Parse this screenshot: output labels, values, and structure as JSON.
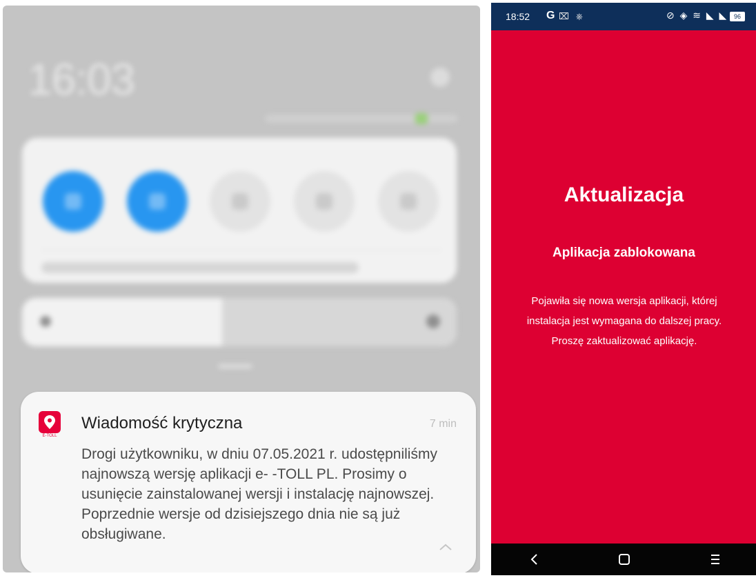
{
  "left_screen": {
    "lock_time": "16:03",
    "notification": {
      "app_icon": "e-toll-app-icon",
      "app_icon_caption": "E-TOLL",
      "title": "Wiadomość krytyczna",
      "time": "7 min",
      "body": "Drogi użytkowniku, w dniu 07.05.2021 r. udostępniliśmy najnowszą wersję aplikacji e-\n-TOLL PL. Prosimy o usunięcie zainstalowanej wersji i instalację najnowszej. Poprzednie wersje od dzisiejszego dnia nie są już obsługiwane.",
      "expand_icon": "chevron-up-icon"
    },
    "quick_tiles": [
      {
        "icon": "pencil-icon",
        "state": "on"
      },
      {
        "icon": "wifi-icon",
        "state": "on"
      },
      {
        "icon": "flashlight-icon",
        "state": "off"
      },
      {
        "icon": "vibrate-icon",
        "state": "off"
      },
      {
        "icon": "screenshot-icon",
        "state": "off"
      }
    ],
    "colors": {
      "tile_on": "#2896f0",
      "shade_bg": "#c4c4c4"
    }
  },
  "right_screen": {
    "status_bar": {
      "time": "18:52",
      "g_label": "G",
      "left_icons": "⌧ ⎈",
      "right_icons": "⊘ ◈ ≋ ◣ ◣",
      "battery": "96"
    },
    "title": "Aktualizacja",
    "subtitle": "Aplikacja zablokowana",
    "message": "Pojawiła się nowa wersja aplikacji, której instalacja jest wymagana do dalszej pracy. Proszę zaktualizować aplikację.",
    "nav": {
      "back_icon": "back-icon",
      "home_icon": "home-icon",
      "recent_icon": "recents-icon"
    },
    "colors": {
      "background": "#dd0032",
      "status_bar": "#0e2f5a",
      "nav_bar": "#050505"
    }
  }
}
